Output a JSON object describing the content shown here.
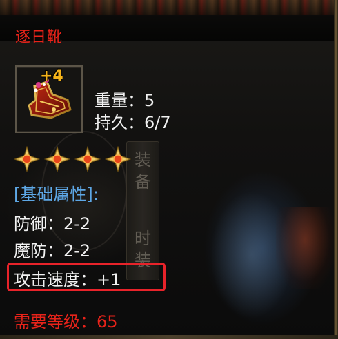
{
  "item": {
    "name": "逐日靴",
    "enhance_level": "+4",
    "icon": "red-boots-icon"
  },
  "stats": {
    "weight_label": "重量：",
    "weight_value": "5",
    "durability_label": "持久：",
    "durability_value": "6/7"
  },
  "stars": {
    "count": 4,
    "icon": "gold-star-gem-icon"
  },
  "attributes": {
    "header": "[基础属性]:",
    "items": [
      {
        "label": "防御：",
        "value": "2-2"
      },
      {
        "label": "魔防：",
        "value": "2-2"
      },
      {
        "label": "攻击速度：",
        "value": "+1"
      }
    ]
  },
  "requirement": {
    "label": "需要等级：",
    "value": "65"
  },
  "background": {
    "tab_chars": [
      "装",
      "备",
      "时",
      "装"
    ]
  },
  "colors": {
    "item_name": "#e8231a",
    "section_header": "#5ea8e6",
    "stat_text": "#f2f2f2",
    "enhance_level": "#f3b21a",
    "requirement": "#e8231a",
    "highlight_box": "#e8232a"
  }
}
